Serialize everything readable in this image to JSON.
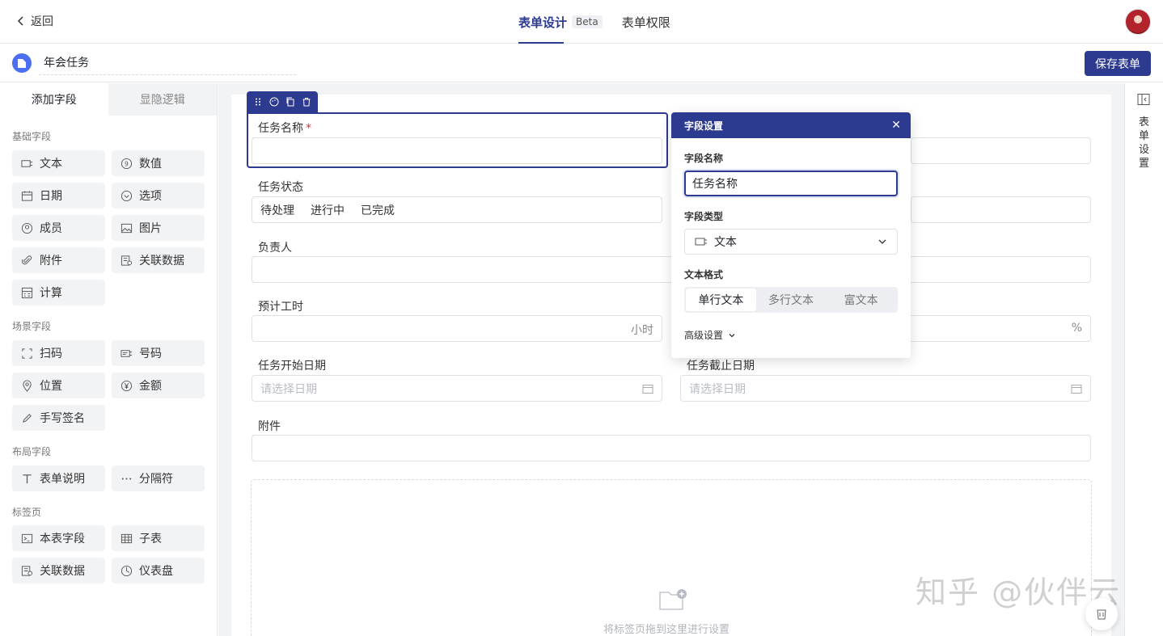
{
  "topbar": {
    "back_label": "返回",
    "tabs": [
      {
        "label": "表单设计",
        "badge": "Beta",
        "active": true
      },
      {
        "label": "表单权限",
        "active": false
      }
    ]
  },
  "form": {
    "title": "年会任务",
    "save_label": "保存表单"
  },
  "left_panel": {
    "tabs": [
      "添加字段",
      "显隐逻辑"
    ],
    "groups": [
      {
        "title": "基础字段",
        "items": [
          {
            "label": "文本",
            "icon": "text-field-icon"
          },
          {
            "label": "数值",
            "icon": "number-icon"
          },
          {
            "label": "日期",
            "icon": "calendar-icon"
          },
          {
            "label": "选项",
            "icon": "select-icon"
          },
          {
            "label": "成员",
            "icon": "member-icon"
          },
          {
            "label": "图片",
            "icon": "image-icon"
          },
          {
            "label": "附件",
            "icon": "paperclip-icon"
          },
          {
            "label": "关联数据",
            "icon": "linked-data-icon"
          },
          {
            "label": "计算",
            "icon": "calculator-icon"
          }
        ]
      },
      {
        "title": "场景字段",
        "items": [
          {
            "label": "扫码",
            "icon": "scan-icon"
          },
          {
            "label": "号码",
            "icon": "number-tag-icon"
          },
          {
            "label": "位置",
            "icon": "location-icon"
          },
          {
            "label": "金额",
            "icon": "yen-icon"
          },
          {
            "label": "手写签名",
            "icon": "signature-icon"
          }
        ]
      },
      {
        "title": "布局字段",
        "items": [
          {
            "label": "表单说明",
            "icon": "text-t-icon"
          },
          {
            "label": "分隔符",
            "icon": "ellipsis-icon"
          }
        ]
      },
      {
        "title": "标签页",
        "items": [
          {
            "label": "本表字段",
            "icon": "table-field-icon"
          },
          {
            "label": "子表",
            "icon": "subtable-icon"
          },
          {
            "label": "关联数据",
            "icon": "linked-data-icon"
          },
          {
            "label": "仪表盘",
            "icon": "dashboard-icon"
          }
        ]
      }
    ]
  },
  "canvas": {
    "fields": {
      "task_name": {
        "label": "任务名称",
        "required_mark": "*"
      },
      "task_status": {
        "label": "任务状态",
        "options": [
          "待处理",
          "进行中",
          "已完成"
        ]
      },
      "owner": {
        "label": "负责人"
      },
      "estimated_hours": {
        "label": "预计工时",
        "suffix": "小时"
      },
      "percent_suffix": "%",
      "start_date": {
        "label": "任务开始日期",
        "placeholder": "请选择日期"
      },
      "end_date": {
        "label": "任务截止日期",
        "placeholder": "请选择日期"
      },
      "attachment": {
        "label": "附件"
      }
    },
    "tab_drop_hint": "将标签页拖到这里进行设置"
  },
  "field_settings": {
    "title": "字段设置",
    "name_label": "字段名称",
    "name_value": "任务名称",
    "type_label": "字段类型",
    "type_value": "文本",
    "format_label": "文本格式",
    "formats": [
      "单行文本",
      "多行文本",
      "富文本"
    ],
    "active_format": "单行文本",
    "advanced_label": "高级设置"
  },
  "right_rail": {
    "label": "表单设置"
  },
  "watermark": "知乎 @伙伴云"
}
